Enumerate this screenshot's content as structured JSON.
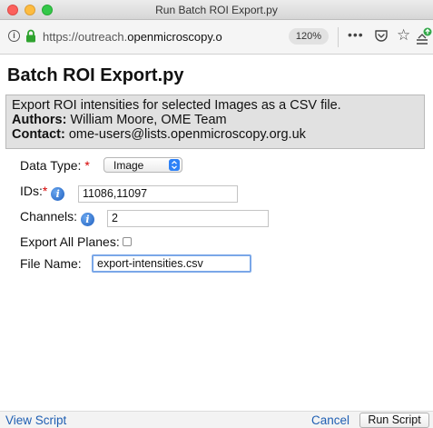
{
  "window": {
    "title": "Run Batch ROI Export.py"
  },
  "browser": {
    "url_prefix": "https://outreach.",
    "url_domain": "openmicroscopy.o",
    "zoom": "120%",
    "more_glyph": "•••",
    "info_glyph": "i",
    "star_glyph": "☆"
  },
  "script": {
    "title": "Batch ROI Export.py",
    "description": "Export ROI intensities for selected Images as a CSV file.",
    "authors_label": "Authors:",
    "authors": "William Moore, OME Team",
    "contact_label": "Contact:",
    "contact": "ome-users@lists.openmicroscopy.org.uk"
  },
  "form": {
    "data_type": {
      "label": "Data Type:",
      "required": "*",
      "value": "Image"
    },
    "ids": {
      "label": "IDs:",
      "required": "*",
      "value": "11086,11097"
    },
    "channels": {
      "label": "Channels:",
      "value": "2"
    },
    "export_all_planes": {
      "label": "Export All Planes:",
      "checked": false
    },
    "file_name": {
      "label": "File Name:",
      "value": "export-intensities.csv"
    },
    "info_glyph": "i"
  },
  "footer": {
    "view_script": "View Script",
    "cancel": "Cancel",
    "run_script": "Run Script"
  },
  "colors": {
    "link": "#1f5fb3",
    "required": "#d60000",
    "select_accent": "#2e82f7",
    "description_bg": "#e1e1e1"
  }
}
